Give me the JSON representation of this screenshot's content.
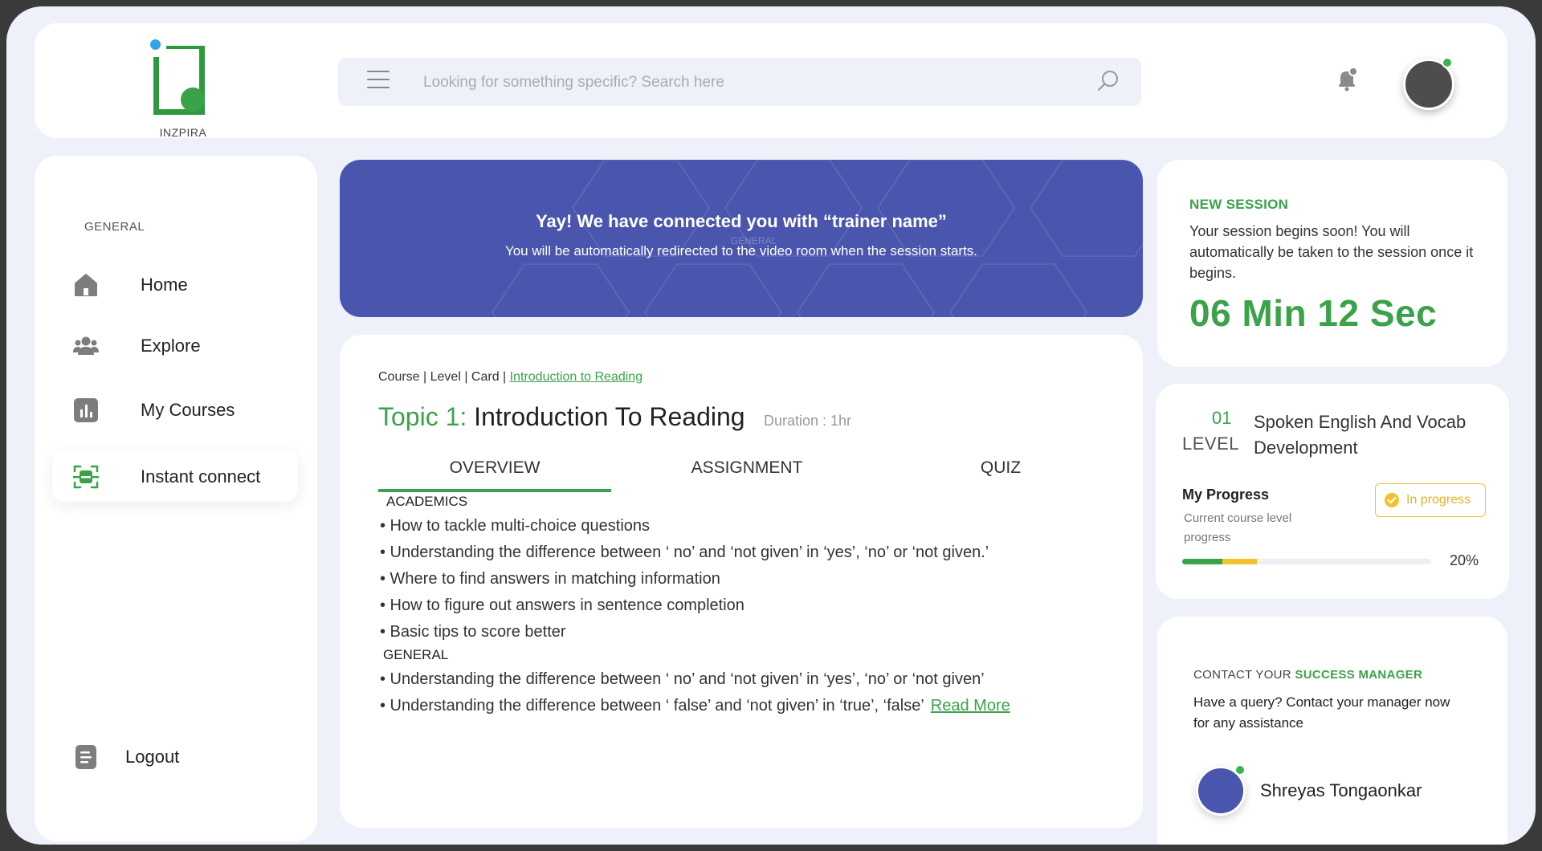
{
  "header": {
    "logo_text": "INZPIRA",
    "search_placeholder": "Looking for something specific? Search here"
  },
  "sidebar": {
    "section_label": "GENERAL",
    "items": [
      {
        "label": "Home",
        "icon": "home-icon"
      },
      {
        "label": "Explore",
        "icon": "users-icon"
      },
      {
        "label": "My Courses",
        "icon": "bar-chart-icon"
      },
      {
        "label": "Instant connect",
        "icon": "scan-icon",
        "active": true
      }
    ],
    "logout_label": "Logout"
  },
  "banner": {
    "title": "Yay! We have connected you with “trainer name”",
    "subtitle": "You will be automatically redirected to the video room when the session starts.",
    "ghost_text": "GENERAL"
  },
  "course": {
    "breadcrumb": {
      "prefix": "Course | Level | Card | ",
      "current": "Introduction to Reading"
    },
    "topic_number": "Topic 1:",
    "topic_title": "Introduction To Reading",
    "duration": "Duration : 1hr",
    "tabs": [
      "OVERVIEW",
      "ASSIGNMENT",
      "QUIZ"
    ],
    "active_tab": "OVERVIEW",
    "sections": [
      {
        "heading": "ACADEMICS",
        "bullets": [
          "• How to tackle multi-choice questions",
          "• Understanding the difference between ‘ no’ and ‘not given’ in ‘yes’, ‘no’ or ‘not given.’",
          "• Where to find answers in matching information",
          "• How to figure out answers in sentence completion",
          "• Basic tips to score better"
        ]
      },
      {
        "heading": "GENERAL",
        "bullets": [
          "• Understanding the difference between ‘ no’ and ‘not given’ in ‘yes’, ‘no’ or ‘not given’",
          "• Understanding the difference between ‘ false’ and ‘not given’ in ‘true’, ‘false’"
        ]
      }
    ],
    "read_more": "Read More"
  },
  "session": {
    "label": "NEW SESSION",
    "text": "Your session begins soon! You will automatically be taken to the session once it begins.",
    "countdown": "06 Min 12 Sec"
  },
  "level": {
    "number": "01",
    "word": "LEVEL",
    "title": "Spoken English And Vocab Development",
    "progress_title": "My Progress",
    "progress_sub": "Current course level progress",
    "status": "In progress",
    "percent_label": "20%",
    "progress": {
      "completed_fraction": 0.16,
      "in_progress_fraction": 0.14
    }
  },
  "contact": {
    "label_prefix": "CONTACT YOUR ",
    "label_highlight": "SUCCESS MANAGER",
    "text": "Have a query? Contact your manager now for any assistance",
    "manager_name": "Shreyas Tongaonkar"
  },
  "colors": {
    "accent_green": "#3aa34a",
    "banner_blue": "#4a56ae",
    "status_yellow": "#e0b423",
    "background": "#eef1f9"
  }
}
